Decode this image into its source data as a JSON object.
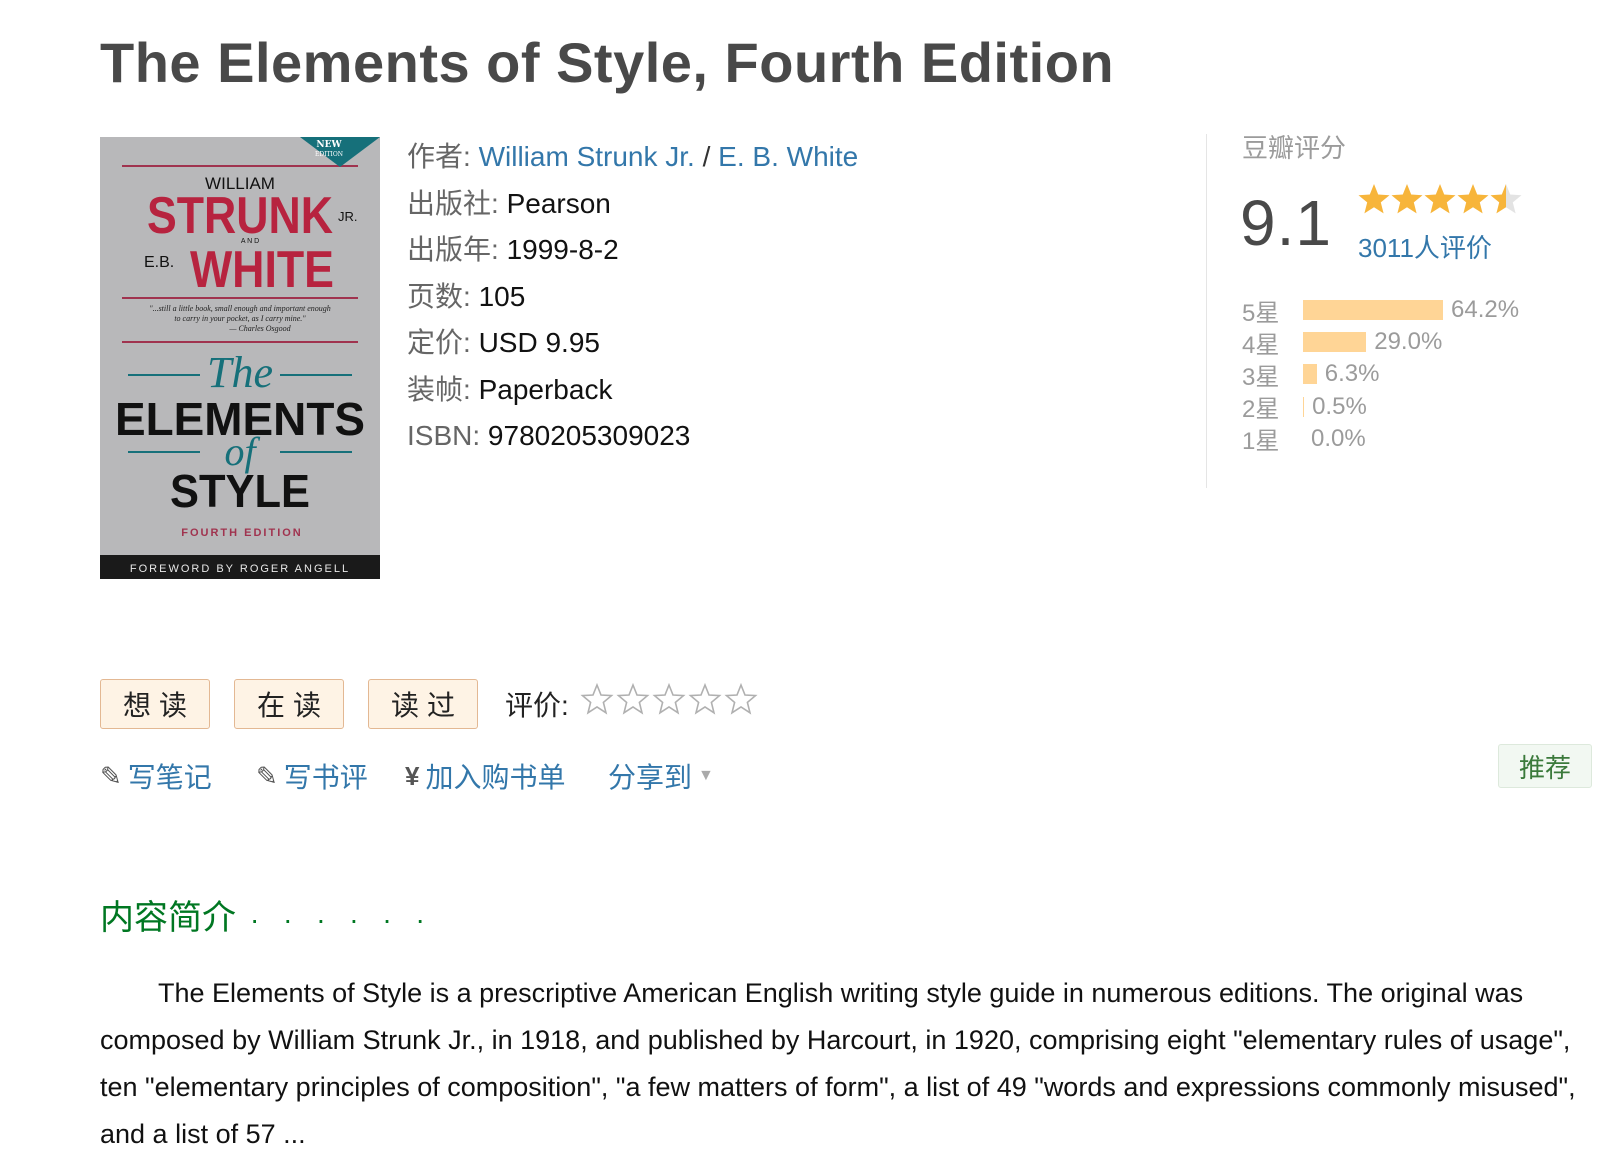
{
  "book": {
    "title": "The Elements of Style, Fourth Edition"
  },
  "cover": {
    "badge_line1": "NEW",
    "badge_line2": "EDITION",
    "william": "WILLIAM",
    "strunk": "STRUNK",
    "jr": "JR.",
    "and": "A N D",
    "eb": "E.B.",
    "white": "WHITE",
    "quote1": "\"...still a little book, small enough and important enough",
    "quote2": "to carry in your pocket, as I carry mine.\"",
    "quote3": "— Charles Osgood",
    "the": "The",
    "elements": "ELEMENTS",
    "of": "of",
    "style": "STYLE",
    "fourth": "FOURTH EDITION",
    "foreword": "FOREWORD BY ROGER ANGELL"
  },
  "info": {
    "author_label": "作者",
    "author1": "William Strunk Jr.",
    "author_sep": " / ",
    "author2": "E. B. White",
    "publisher_label": "出版社",
    "publisher": "Pearson",
    "year_label": "出版年",
    "year": "1999-8-2",
    "pages_label": "页数",
    "pages": "105",
    "price_label": "定价",
    "price": "USD 9.95",
    "binding_label": "装帧",
    "binding": "Paperback",
    "isbn_label": "ISBN",
    "isbn": "9780205309023"
  },
  "rating": {
    "label": "豆瓣评分",
    "score": "9.1",
    "stars_value": 4.5,
    "count_text": "3011人评价",
    "distribution": [
      {
        "label": "5星",
        "value": 64.2,
        "text": "64.2%"
      },
      {
        "label": "4星",
        "value": 29.0,
        "text": "29.0%"
      },
      {
        "label": "3星",
        "value": 6.3,
        "text": "6.3%"
      },
      {
        "label": "2星",
        "value": 0.5,
        "text": "0.5%"
      },
      {
        "label": "1星",
        "value": 0.0,
        "text": "0.0%"
      }
    ],
    "bar_color": "#ffd596"
  },
  "actions": {
    "want": "想读",
    "reading": "在读",
    "read": "读过",
    "rate_label": "评价:",
    "rate_stars": 5,
    "note_icon": "pencil-icon",
    "note": "写笔记",
    "review": "写书评",
    "cart_icon": "yen-icon",
    "cart": "加入购书单",
    "share": "分享到",
    "recommend": "推荐"
  },
  "intro": {
    "heading": "内容简介",
    "dots": "· · · · · ·",
    "text": "The Elements of Style is a prescriptive American English writing style guide in numerous editions. The original was composed by William Strunk Jr., in 1918, and published by Harcourt, in 1920, comprising eight \"elementary rules of usage\", ten \"elementary principles of composition\", \"a few matters of form\", a list of 49 \"words and expressions commonly misused\", and a list of 57 ..."
  }
}
